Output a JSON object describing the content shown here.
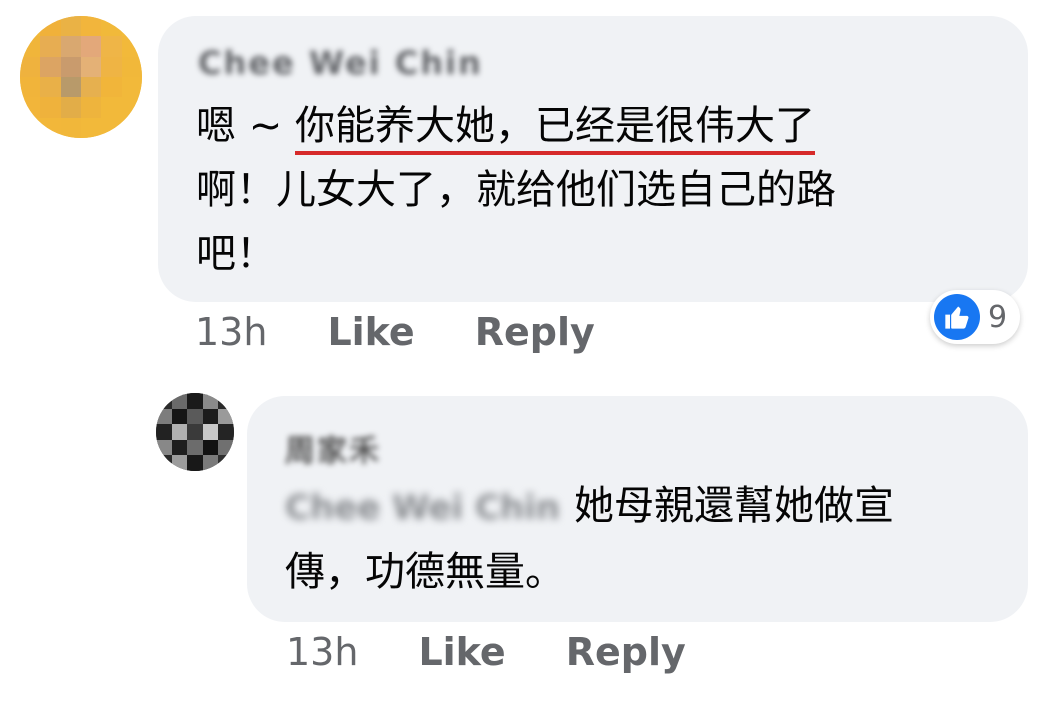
{
  "comments": [
    {
      "author": "Chee Wei Chin",
      "text_line1_prefix": "嗯 ~ ",
      "text_line1_highlight": "你能养大她，已经是很伟大了",
      "text_line2": "啊！儿女大了，就给他们选自己的路",
      "text_line3": "吧！",
      "time": "13h",
      "like_label": "Like",
      "reply_label": "Reply",
      "reaction_count": "9"
    },
    {
      "author": "周家禾",
      "mention": "Chee Wei Chin",
      "text_line1": "她母親還幫她做宣",
      "text_line2": "傳，功德無量。",
      "time": "13h",
      "like_label": "Like",
      "reply_label": "Reply"
    }
  ],
  "colors": {
    "bubble": "#f0f2f5",
    "action_text": "#65676b",
    "like_blue": "#1877f2",
    "underline_red": "#d62a2a"
  },
  "icons": {
    "reaction": "thumbs-up-icon"
  }
}
